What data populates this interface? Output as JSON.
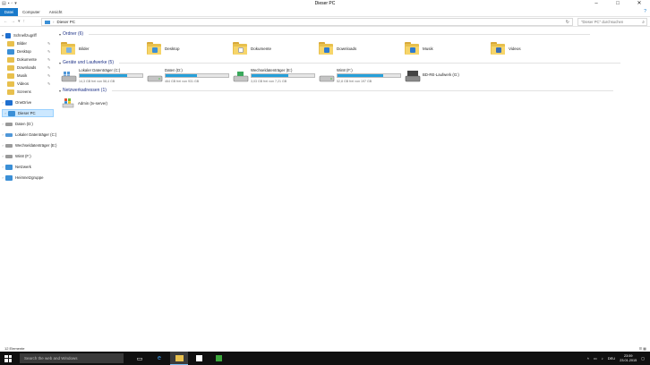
{
  "window": {
    "title": "Dieser PC"
  },
  "ribbon": {
    "tabs": [
      "Datei",
      "Computer",
      "Ansicht"
    ]
  },
  "address": {
    "path": "Dieser PC"
  },
  "search": {
    "placeholder": "\"Dieser PC\" durchsuchen"
  },
  "navpane": {
    "items": [
      {
        "label": "Schnellzugriff",
        "color": "#1e6fd0"
      },
      {
        "label": "Bilder",
        "color": "#e8c04d"
      },
      {
        "label": "Desktop",
        "color": "#3b8fd6"
      },
      {
        "label": "Dokumente",
        "color": "#e8c04d"
      },
      {
        "label": "Downloads",
        "color": "#e8c04d"
      },
      {
        "label": "Musik",
        "color": "#e8c04d"
      },
      {
        "label": "Videos",
        "color": "#e8c04d"
      },
      {
        "label": "Screens",
        "color": "#e8c04d"
      },
      {
        "label": "OneDrive",
        "color": "#1e6fd0"
      },
      {
        "label": "Dieser PC",
        "color": "#3b8fd6"
      },
      {
        "label": "Daten (D:)",
        "color": "#9a9a9a"
      },
      {
        "label": "Lokaler Datenträger (C:)",
        "color": "#4f97d8"
      },
      {
        "label": "Wechseldatenträger (E:)",
        "color": "#9a9a9a"
      },
      {
        "label": "Win8 (F:)",
        "color": "#9a9a9a"
      },
      {
        "label": "Netzwerk",
        "color": "#3b8fd6"
      },
      {
        "label": "Heimnetzgruppe",
        "color": "#3b8fd6"
      }
    ]
  },
  "groups": {
    "folders": "Ordner (6)",
    "drives": "Geräte und Laufwerke (5)",
    "network": "Netzwerkadressen (1)"
  },
  "folders": [
    {
      "label": "Bilder",
      "badge": "#7fb3e0"
    },
    {
      "label": "Desktop",
      "badge": "#3b8fd6"
    },
    {
      "label": "Dokumente",
      "badge": "#ffffff"
    },
    {
      "label": "Downloads",
      "badge": "#2e7bd0"
    },
    {
      "label": "Musik",
      "badge": "#2e7bd0"
    },
    {
      "label": "Videos",
      "badge": "#3b6fb6"
    }
  ],
  "drives": [
    {
      "name": "Lokaler Datenträger (C:)",
      "free": "14,3 GB frei von 58,4 GB",
      "used_fraction": 0.76
    },
    {
      "name": "Daten (D:)",
      "free": "464 GB frei von 931 GB",
      "used_fraction": 0.5
    },
    {
      "name": "Wechseldatenträger (E:)",
      "free": "3,03 GB frei von 7,21 GB",
      "used_fraction": 0.58
    },
    {
      "name": "Win8 (F:)",
      "free": "52,8 GB frei von 197 GB",
      "used_fraction": 0.73
    },
    {
      "name": "BD-RE-Laufwerk (G:)",
      "free": "",
      "used_fraction": null
    }
  ],
  "network": [
    {
      "label": "Admin (tv-server)"
    }
  ],
  "status": {
    "count": "12 Elemente"
  },
  "taskbar": {
    "search_placeholder": "Search the web and Windows",
    "lang": "DEU",
    "time": "23:59",
    "date": "23.01.2015"
  },
  "colors": {
    "accent": "#1979ca",
    "taskbar": "#101010",
    "selection": "#cce8ff"
  }
}
